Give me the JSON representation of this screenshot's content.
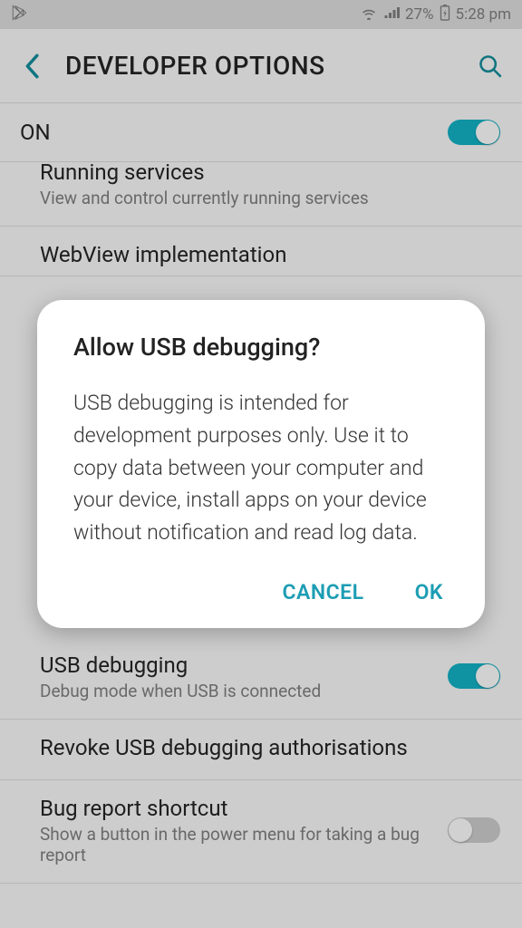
{
  "status_bar": {
    "battery_text": "27%",
    "time": "5:28 pm"
  },
  "header": {
    "title": "DEVELOPER OPTIONS"
  },
  "master_toggle": {
    "label": "ON",
    "state": true
  },
  "items": {
    "running": {
      "title": "Running services",
      "sub": "View and control currently running services"
    },
    "webview": {
      "title": "WebView implementation"
    },
    "usb_debug": {
      "title": "USB debugging",
      "sub": "Debug mode when USB is connected",
      "state": true
    },
    "revoke": {
      "title": "Revoke USB debugging authorisations"
    },
    "bug_report": {
      "title": "Bug report shortcut",
      "sub": "Show a button in the power menu for taking a bug report",
      "state": false
    }
  },
  "dialog": {
    "title": "Allow USB debugging?",
    "body": "USB debugging is intended for development purposes only. Use it to copy data between your computer and your device, install apps on your device without notification and read log data.",
    "cancel": "CANCEL",
    "ok": "OK"
  }
}
